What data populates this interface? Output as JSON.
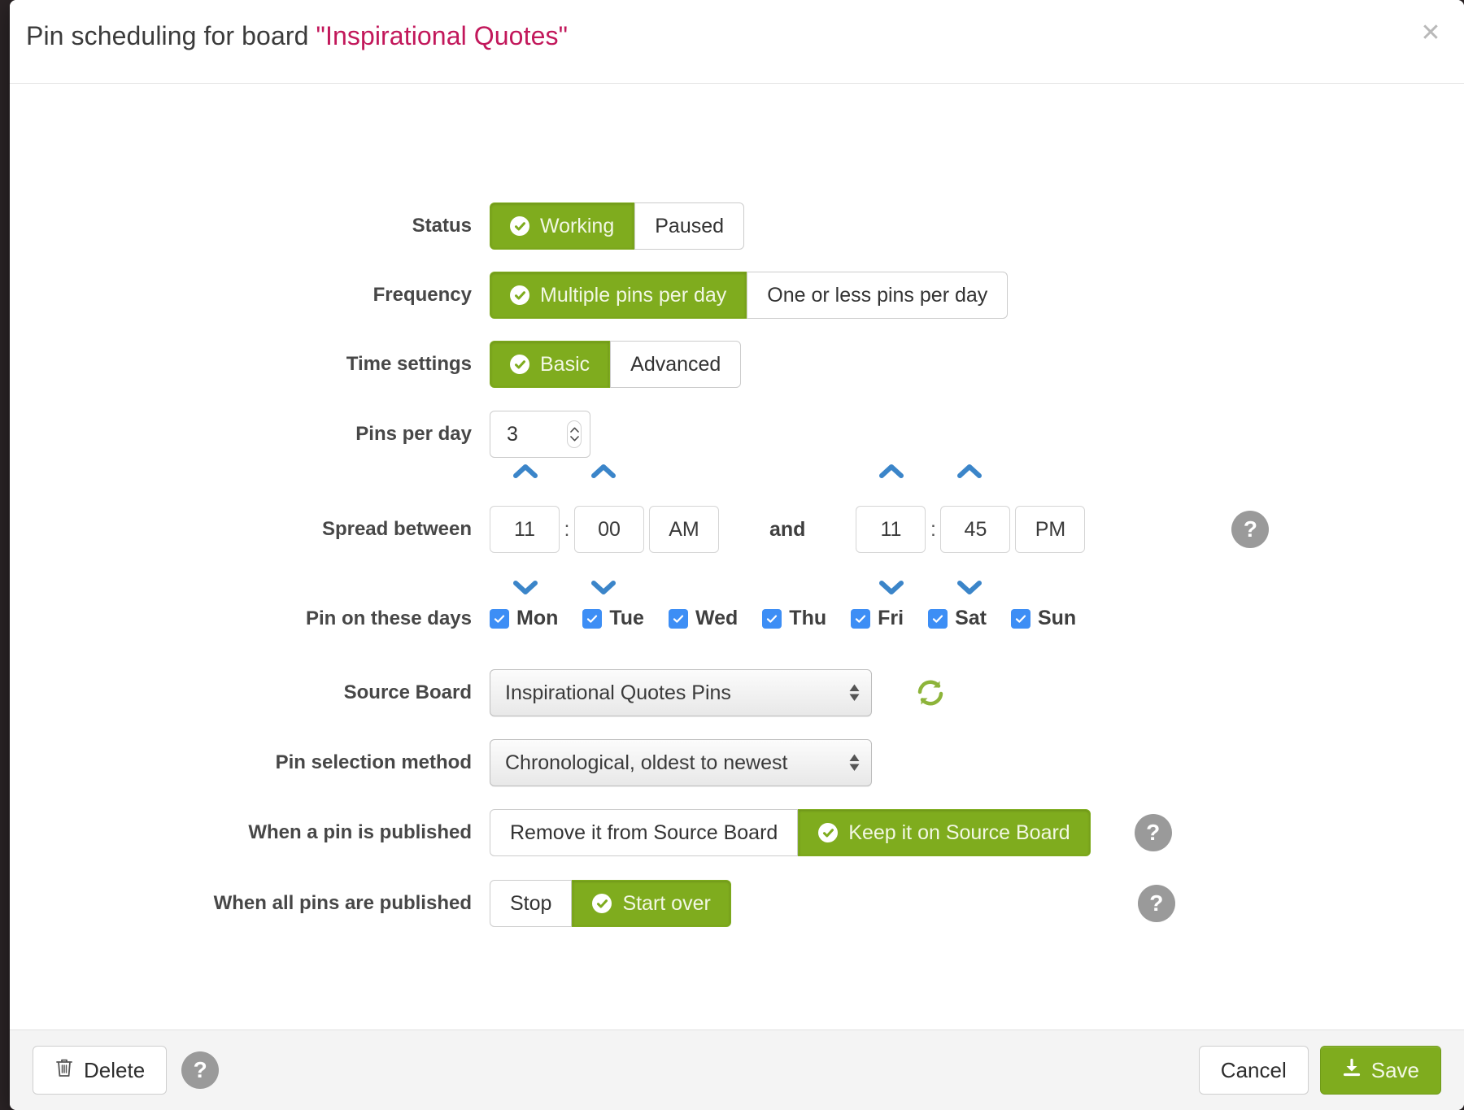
{
  "header": {
    "title_prefix": "Pin scheduling for board ",
    "board_name": "\"Inspirational Quotes\"",
    "close_icon": "close-icon",
    "accent_color": "#c2185b"
  },
  "theme": {
    "green": "#7fac1e",
    "blue": "#3d8ef5",
    "help_gray": "#9a9a9a"
  },
  "rows": {
    "status": {
      "label": "Status",
      "options": [
        "Working",
        "Paused"
      ],
      "selected": "Working"
    },
    "frequency": {
      "label": "Frequency",
      "options": [
        "Multiple pins per day",
        "One or less pins per day"
      ],
      "selected": "Multiple pins per day"
    },
    "time_settings": {
      "label": "Time settings",
      "options": [
        "Basic",
        "Advanced"
      ],
      "selected": "Basic"
    },
    "pins_per_day": {
      "label": "Pins per day",
      "value": "3"
    },
    "spread_between": {
      "label": "Spread between",
      "and_label": "and",
      "colon": ":",
      "start": {
        "hour": "11",
        "minute": "00",
        "meridiem": "AM"
      },
      "end": {
        "hour": "11",
        "minute": "45",
        "meridiem": "PM"
      },
      "help": "?"
    },
    "pin_on_these_days": {
      "label": "Pin on these days",
      "days": [
        {
          "label": "Mon",
          "checked": true
        },
        {
          "label": "Tue",
          "checked": true
        },
        {
          "label": "Wed",
          "checked": true
        },
        {
          "label": "Thu",
          "checked": true
        },
        {
          "label": "Fri",
          "checked": true
        },
        {
          "label": "Sat",
          "checked": true
        },
        {
          "label": "Sun",
          "checked": true
        }
      ]
    },
    "source_board": {
      "label": "Source Board",
      "value": "Inspirational Quotes Pins",
      "refresh_icon": "refresh-icon"
    },
    "pin_selection_method": {
      "label": "Pin selection method",
      "value": "Chronological, oldest to newest"
    },
    "when_pin_published": {
      "label": "When a pin is published",
      "options": [
        "Remove it from Source Board",
        "Keep it on Source Board"
      ],
      "selected": "Keep it on Source Board",
      "help": "?"
    },
    "when_all_published": {
      "label": "When all pins are published",
      "options": [
        "Stop",
        "Start over"
      ],
      "selected": "Start over",
      "help": "?"
    }
  },
  "footer": {
    "delete_label": "Delete",
    "help": "?",
    "cancel_label": "Cancel",
    "save_label": "Save"
  }
}
